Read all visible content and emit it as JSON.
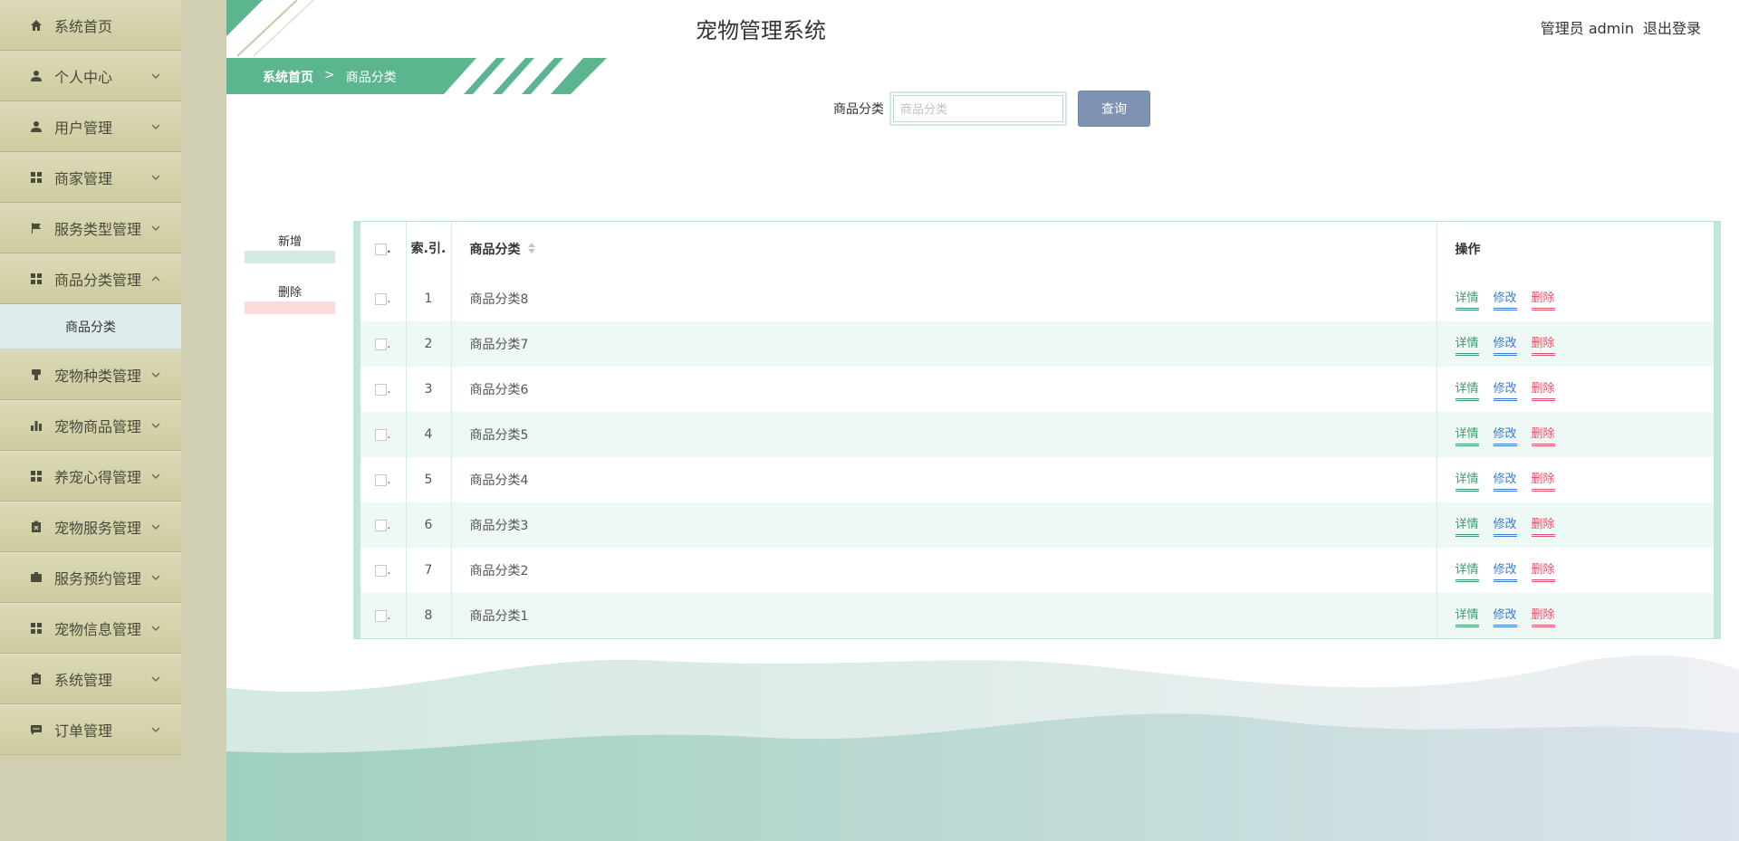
{
  "app": {
    "title": "宠物管理系统"
  },
  "header": {
    "user_label": "管理员 admin",
    "logout": "退出登录"
  },
  "breadcrumb": {
    "home": "系统首页",
    "separator": ">",
    "current": "商品分类"
  },
  "sidebar": {
    "items": [
      {
        "label": "系统首页",
        "icon": "home-icon",
        "has_children": false
      },
      {
        "label": "个人中心",
        "icon": "user-icon",
        "has_children": true
      },
      {
        "label": "用户管理",
        "icon": "user-icon",
        "has_children": true
      },
      {
        "label": "商家管理",
        "icon": "grid-icon",
        "has_children": true
      },
      {
        "label": "服务类型管理",
        "icon": "flag-icon",
        "has_children": true
      },
      {
        "label": "商品分类管理",
        "icon": "grid-icon",
        "has_children": true,
        "expanded": true
      },
      {
        "label": "宠物种类管理",
        "icon": "brush-icon",
        "has_children": true
      },
      {
        "label": "宠物商品管理",
        "icon": "bar-chart-icon",
        "has_children": true
      },
      {
        "label": "养宠心得管理",
        "icon": "grid-icon",
        "has_children": true
      },
      {
        "label": "宠物服务管理",
        "icon": "clipboard-x-icon",
        "has_children": true
      },
      {
        "label": "服务预约管理",
        "icon": "briefcase-icon",
        "has_children": true
      },
      {
        "label": "宠物信息管理",
        "icon": "grid-icon",
        "has_children": true
      },
      {
        "label": "系统管理",
        "icon": "clipboard-icon",
        "has_children": true
      },
      {
        "label": "订单管理",
        "icon": "chat-icon",
        "has_children": true
      }
    ],
    "submenu": {
      "label": "商品分类"
    }
  },
  "search": {
    "label": "商品分类",
    "placeholder": "商品分类",
    "value": "",
    "button": "查询"
  },
  "actions": {
    "add": "新增",
    "delete": "删除"
  },
  "table": {
    "headers": {
      "check": ".",
      "index": "索.引.",
      "name": "商品分类",
      "ops": "操作"
    },
    "rows": [
      {
        "index": "1",
        "name": "商品分类8"
      },
      {
        "index": "2",
        "name": "商品分类7"
      },
      {
        "index": "3",
        "name": "商品分类6"
      },
      {
        "index": "4",
        "name": "商品分类5"
      },
      {
        "index": "5",
        "name": "商品分类4"
      },
      {
        "index": "6",
        "name": "商品分类3"
      },
      {
        "index": "7",
        "name": "商品分类2"
      },
      {
        "index": "8",
        "name": "商品分类1"
      }
    ],
    "ops": {
      "detail": "详情",
      "edit": "修改",
      "delete": "删除"
    }
  },
  "colors": {
    "brand_green": "#5bb58f",
    "sidebar": "#d1cfb1",
    "query_button": "#7d93b1"
  }
}
